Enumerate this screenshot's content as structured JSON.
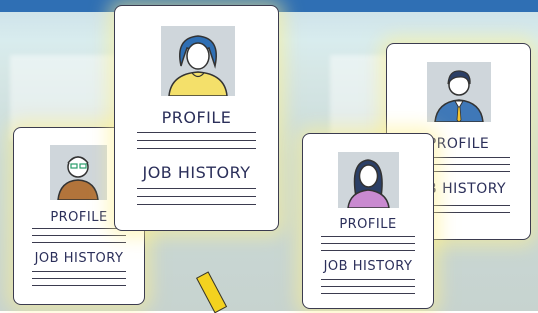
{
  "cards": [
    {
      "id": "card-back-left",
      "profile": "PROFILE",
      "job": "JOB HISTORY"
    },
    {
      "id": "card-front-top",
      "profile": "PROFILE",
      "job": "JOB HISTORY"
    },
    {
      "id": "card-front-right",
      "profile": "PROFILE",
      "job": "JOB HISTORY"
    },
    {
      "id": "card-back-right",
      "profile": "PROFILE",
      "job": "JOB HISTORY"
    }
  ],
  "colors": {
    "accent": "#2b2f5a",
    "highlight": "#fff08c",
    "banner": "#2f6fb4"
  }
}
